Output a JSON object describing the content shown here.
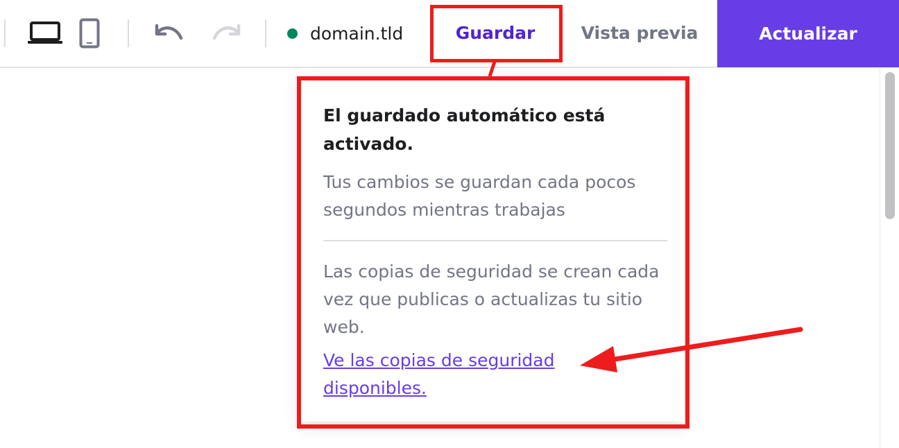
{
  "toolbar": {
    "domain_label": "domain.tld",
    "status_color": "#00875a",
    "save_label": "Guardar",
    "preview_label": "Vista previa",
    "update_label": "Actualizar",
    "accent_color": "#673de6",
    "icons": [
      "laptop-icon",
      "mobile-icon",
      "undo-icon",
      "redo-icon"
    ]
  },
  "popover": {
    "title": "El guardado automático está activado.",
    "autosave_text": "Tus cambios se guardan cada pocos segundos mientras trabajas",
    "backup_text": "Las copias de seguridad se crean cada vez que publicas o actualizas tu sitio web.",
    "backup_link": "Ve las copias de seguridad disponibles."
  },
  "annotation": {
    "highlight_color": "#ee1c1c"
  }
}
